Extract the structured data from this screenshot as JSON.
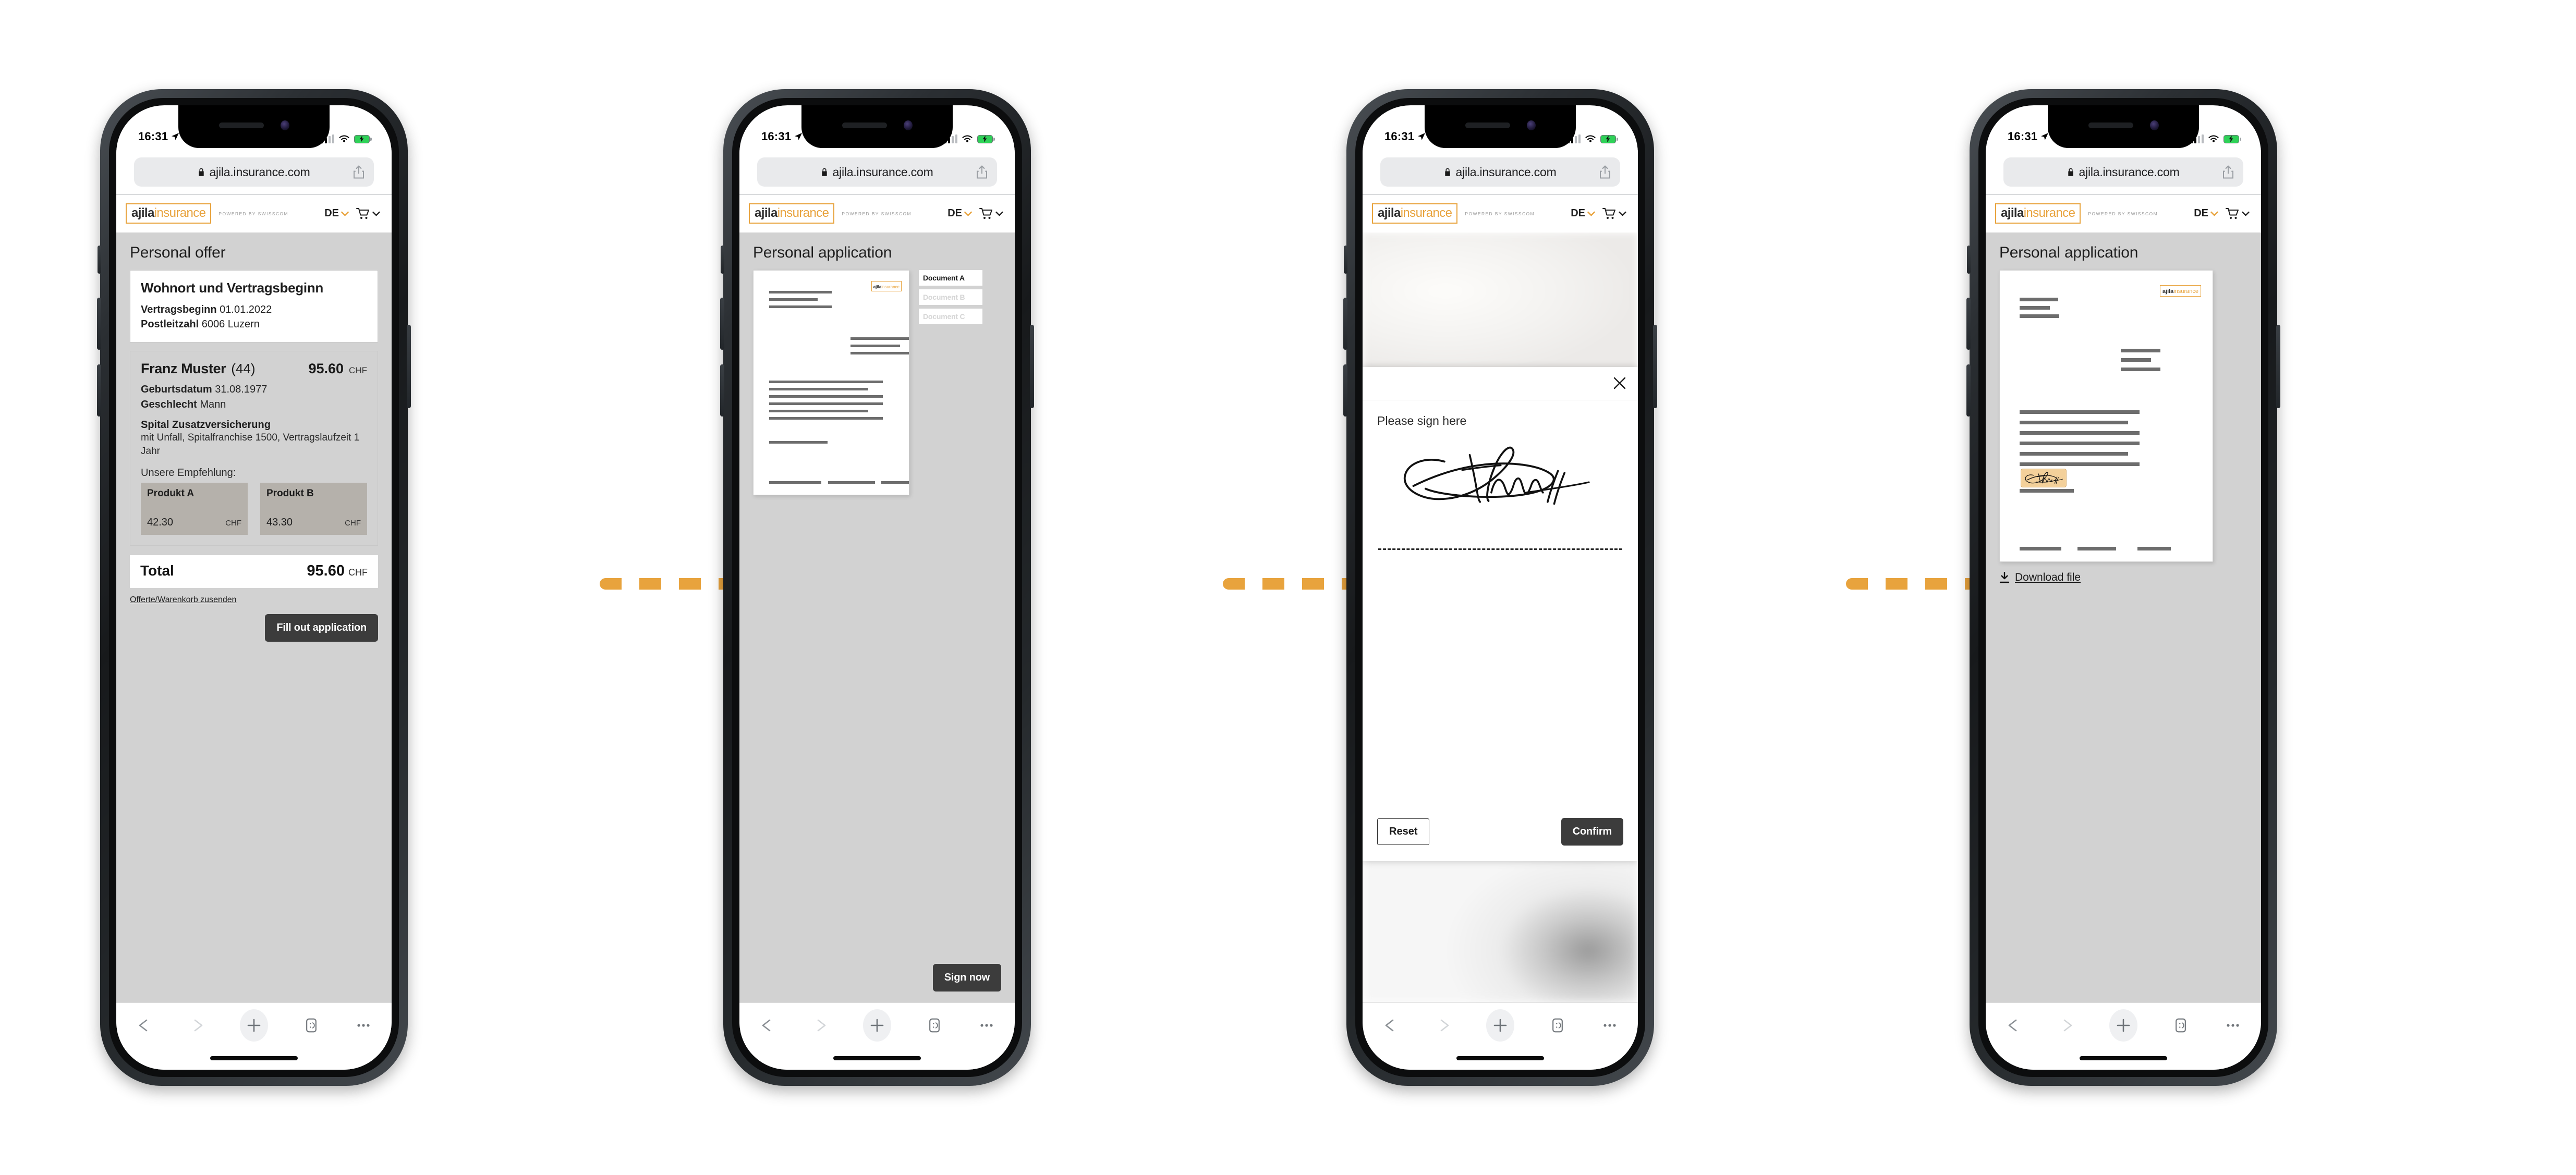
{
  "theme": {
    "accent": "#e8a33d",
    "page_bg": "#d2d2d2",
    "dark_button": "#3c3c3c",
    "doc_line": "#6d6d6d",
    "signature_stamp": "#f3d09a"
  },
  "status_bar": {
    "time": "16:31",
    "location_icon": "location-arrow-icon",
    "signal_icon": "cellular-signal-icon",
    "wifi_icon": "wifi-icon",
    "battery_icon": "battery-charging-icon"
  },
  "browser": {
    "url": "ajila.insurance.com",
    "lock_icon": "lock-icon",
    "share_icon": "share-icon",
    "toolbar": {
      "back_icon": "back-arrow-icon",
      "forward_icon": "forward-arrow-icon",
      "new_tab_icon": "plus-icon",
      "tabs_icon": "tabs-icon",
      "more_icon": "more-ellipsis-icon"
    }
  },
  "site_header": {
    "logo_primary": "ajila",
    "logo_secondary": "insurance",
    "powered_by": "POWERED BY SWISSCOM",
    "language": "DE",
    "language_chevron_icon": "chevron-down-icon",
    "cart_icon": "shopping-cart-icon",
    "cart_chevron_icon": "chevron-down-icon"
  },
  "screens": [
    {
      "id": "offer",
      "page_title": "Personal offer",
      "location_card": {
        "heading": "Wohnort und Vertragsbeginn",
        "rows": [
          {
            "label": "Vertragsbeginn",
            "value": "01.01.2022"
          },
          {
            "label": "Postleitzahl",
            "value": "6006 Luzern"
          }
        ]
      },
      "person_card": {
        "name": "Franz Muster",
        "age": "(44)",
        "price": "95.60",
        "currency": "CHF",
        "rows": [
          {
            "label": "Geburtsdatum",
            "value": "31.08.1977"
          },
          {
            "label": "Geschlecht",
            "value": "Mann"
          }
        ],
        "product_title": "Spital Zusatzversicherung",
        "product_subtitle": "mit Unfall, Spitalfranchise 1500, Vertragslaufzeit 1 Jahr",
        "recommendation_label": "Unsere Empfehlung:",
        "products": [
          {
            "name": "Produkt A",
            "price": "42.30",
            "currency": "CHF"
          },
          {
            "name": "Produkt B",
            "price": "43.30",
            "currency": "CHF"
          }
        ]
      },
      "total": {
        "label": "Total",
        "value": "95.60",
        "currency": "CHF"
      },
      "quote_link": "Offerte/Warenkorb zusenden",
      "primary_button": "Fill out application"
    },
    {
      "id": "application",
      "page_title": "Personal application",
      "document_tabs": [
        {
          "label": "Document A",
          "active": true
        },
        {
          "label": "Document B",
          "active": false
        },
        {
          "label": "Document C",
          "active": false
        }
      ],
      "document_logo_primary": "ajila",
      "document_logo_secondary": "insurance",
      "primary_button": "Sign now"
    },
    {
      "id": "signature",
      "modal": {
        "close_icon": "close-icon",
        "prompt": "Please sign here",
        "signature_glyph": "handwritten-signature",
        "reset_button": "Reset",
        "confirm_button": "Confirm"
      }
    },
    {
      "id": "signed",
      "page_title": "Personal application",
      "document_logo_primary": "ajila",
      "document_logo_secondary": "insurance",
      "signature_stamp_icon": "signature-stamp-icon",
      "download_icon": "download-icon",
      "download_label": "Download file"
    }
  ]
}
